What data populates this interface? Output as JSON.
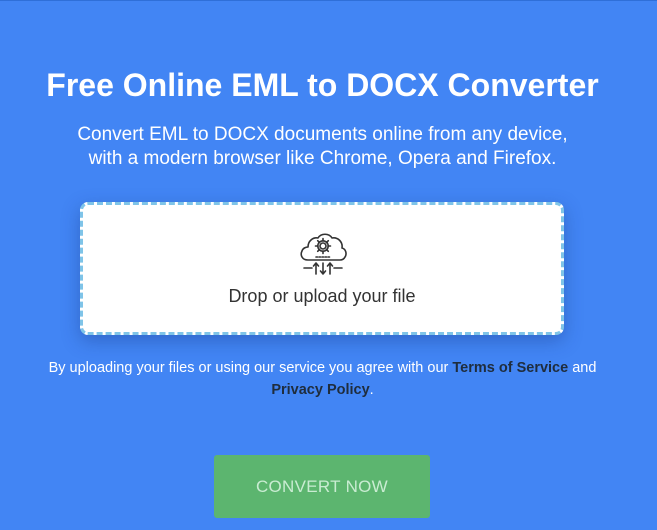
{
  "hero": {
    "title": "Free Online EML to DOCX Converter",
    "subtitle_line1": "Convert EML to DOCX documents online from any device,",
    "subtitle_line2": "with a modern browser like Chrome, Opera and Firefox."
  },
  "dropzone": {
    "icon": "cloud-upload-gear-icon",
    "label": "Drop or upload your file"
  },
  "agreement": {
    "prefix": "By uploading your files or using our service you agree with our ",
    "terms_link": "Terms of Service",
    "conjunction": " and",
    "privacy_link": "Privacy Policy",
    "suffix": "."
  },
  "convert_button": {
    "label": "CONVERT NOW"
  },
  "colors": {
    "background": "#4285f4",
    "button": "#5cb56f",
    "dropzone_border": "#7fc4e8"
  }
}
